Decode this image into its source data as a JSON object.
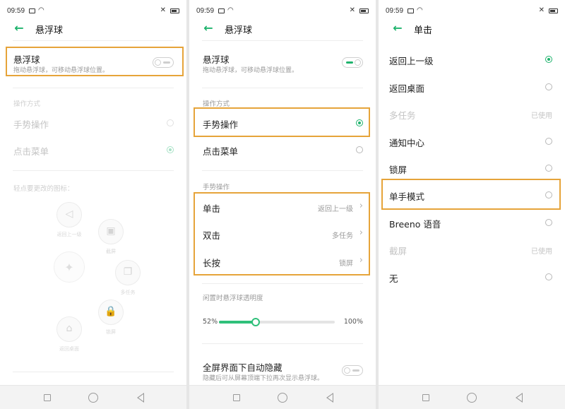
{
  "accent": "#1fb36d",
  "highlight": "#e6a43a",
  "status": {
    "time": "09:59"
  },
  "panel1": {
    "title": "悬浮球",
    "toggle_label": "悬浮球",
    "toggle_sub": "拖动悬浮球，可移动悬浮球位置。",
    "toggle_on": false,
    "section_ops": "操作方式",
    "opt_gesture": "手势操作",
    "opt_menu": "点击菜单",
    "section_menu": "轻点要更改的图标：",
    "menu_icons": [
      {
        "icon": "back-triangle-icon",
        "label": "返回上一级"
      },
      {
        "icon": "screenshot-icon",
        "label": "截屏"
      },
      {
        "icon": "recent-tasks-icon",
        "label": "多任务"
      },
      {
        "icon": "lock-icon",
        "label": "锁屏"
      },
      {
        "icon": "home-icon",
        "label": "返回桌面"
      },
      {
        "icon": "center-dot-icon",
        "label": ""
      }
    ]
  },
  "panel2": {
    "title": "悬浮球",
    "toggle_label": "悬浮球",
    "toggle_sub": "拖动悬浮球，可移动悬浮球位置。",
    "toggle_on": true,
    "section_ops": "操作方式",
    "opt_gesture": "手势操作",
    "opt_menu": "点击菜单",
    "section_gesture": "手势操作",
    "gestures": [
      {
        "label": "单击",
        "value": "返回上一级"
      },
      {
        "label": "双击",
        "value": "多任务"
      },
      {
        "label": "长按",
        "value": "锁屏"
      }
    ],
    "section_opacity": "闲置时悬浮球透明度",
    "opacity_min": "52%",
    "opacity_max": "100%",
    "opacity_fraction": 0.32,
    "autohide_label": "全屏界面下自动隐藏",
    "autohide_sub": "隐藏后可从屏幕顶端下拉再次显示悬浮球。",
    "autohide_on": false
  },
  "panel3": {
    "title": "单击",
    "options": [
      {
        "label": "返回上一级",
        "state": "selected"
      },
      {
        "label": "返回桌面",
        "state": "normal"
      },
      {
        "label": "多任务",
        "state": "used",
        "value": "已使用"
      },
      {
        "label": "通知中心",
        "state": "normal"
      },
      {
        "label": "锁屏",
        "state": "normal"
      },
      {
        "label": "单手模式",
        "state": "normal"
      },
      {
        "label": "Breeno 语音",
        "state": "normal"
      },
      {
        "label": "截屏",
        "state": "used",
        "value": "已使用"
      },
      {
        "label": "无",
        "state": "normal"
      }
    ]
  }
}
